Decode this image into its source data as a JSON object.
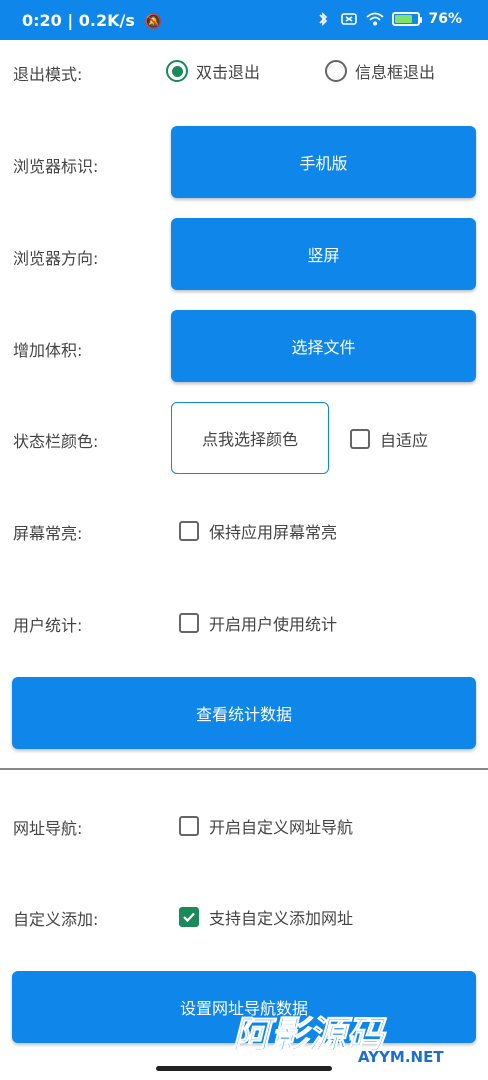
{
  "status_bar": {
    "time_speed": "0:20 | 0.2K/s",
    "battery_percent": "76%",
    "battery_level": 0.76
  },
  "exit_mode": {
    "label": "退出模式:",
    "options": [
      {
        "label": "双击退出",
        "selected": true
      },
      {
        "label": "信息框退出",
        "selected": false
      }
    ]
  },
  "browser_ua": {
    "label": "浏览器标识:",
    "button": "手机版"
  },
  "browser_orientation": {
    "label": "浏览器方向:",
    "button": "竖屏"
  },
  "add_size": {
    "label": "增加体积:",
    "button": "选择文件"
  },
  "status_color": {
    "label": "状态栏颜色:",
    "button": "点我选择颜色",
    "adaptive_label": "自适应",
    "adaptive_checked": false
  },
  "screen_on": {
    "label": "屏幕常亮:",
    "checkbox_label": "保持应用屏幕常亮",
    "checked": false
  },
  "user_stats": {
    "label": "用户统计:",
    "checkbox_label": "开启用户使用统计",
    "checked": false
  },
  "view_stats_button": "查看统计数据",
  "url_nav": {
    "label": "网址导航:",
    "checkbox_label": "开启自定义网址导航",
    "checked": false
  },
  "custom_add": {
    "label": "自定义添加:",
    "checkbox_label": "支持自定义添加网址",
    "checked": true
  },
  "set_nav_button": "设置网址导航数据",
  "watermark": {
    "main": "阿影源码",
    "sub": "AYYM.NET"
  },
  "colors": {
    "primary": "#0f86e9",
    "accent": "#1b8a5a"
  }
}
